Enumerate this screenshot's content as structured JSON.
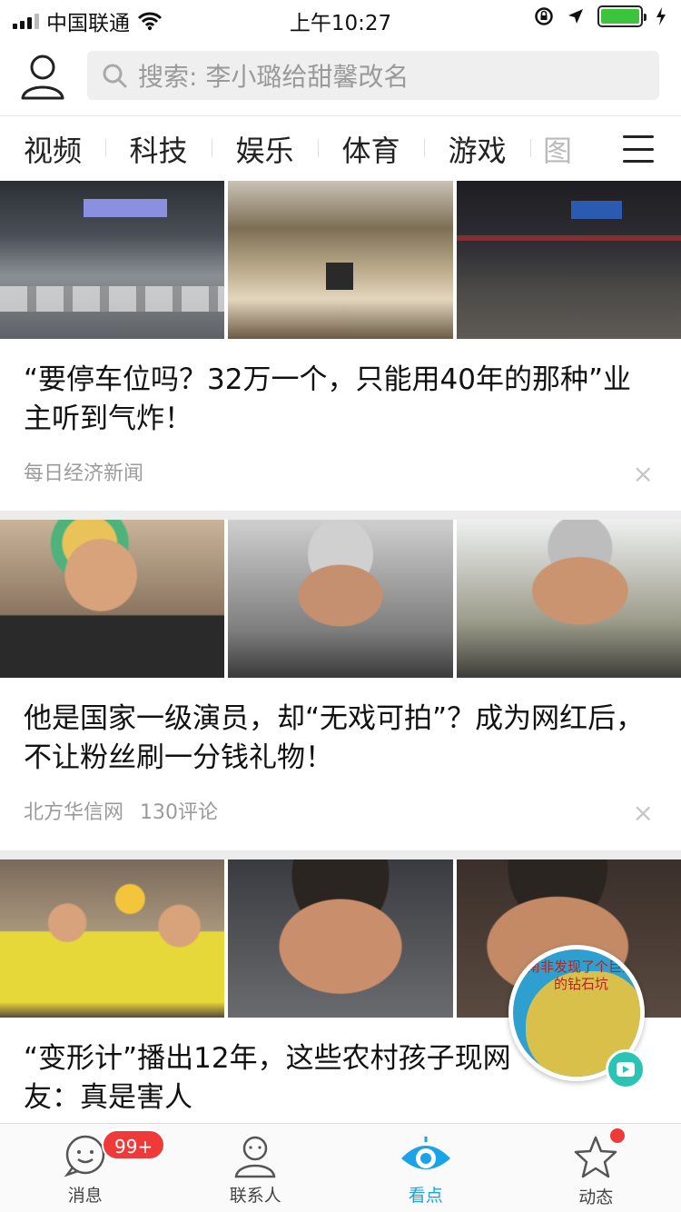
{
  "status_bar": {
    "carrier": "中国联通",
    "time": "上午10:27"
  },
  "search": {
    "placeholder": "搜索: 李小璐给甜馨改名"
  },
  "tabs": [
    {
      "label": "视频"
    },
    {
      "label": "科技"
    },
    {
      "label": "娱乐"
    },
    {
      "label": "体育"
    },
    {
      "label": "游戏"
    },
    {
      "label": "图"
    }
  ],
  "feed": [
    {
      "title": "“要停车位吗？32万一个，只能用40年的那种”业主听到气炸！",
      "source": "每日经济新闻",
      "comments": "",
      "close": "×",
      "images": [
        "parking-garage-image",
        "parking-lot-image",
        "parking-exit-image"
      ]
    },
    {
      "title": "他是国家一级演员，却“无戏可拍”？成为网红后，不让粉丝刷一分钱礼物！",
      "source": "北方华信网",
      "comments": "130评论",
      "close": "×",
      "images": [
        "actor-portrait-image",
        "actor-talking-image",
        "actor-closeup-image"
      ]
    },
    {
      "title": "“变形计”播出12年，这些农村孩子现网友：真是害人",
      "source": "",
      "comments": "",
      "close": "",
      "images": [
        "family-photo-image",
        "boy-crying-image",
        "boy-closeup-image"
      ]
    }
  ],
  "floating_video": {
    "caption": "南非发现了个巨大的钻石坑"
  },
  "tabbar": [
    {
      "label": "消息",
      "badge": "99+",
      "icon": "chat-bubble-icon"
    },
    {
      "label": "联系人",
      "icon": "person-icon"
    },
    {
      "label": "看点",
      "icon": "eye-icon",
      "active": true
    },
    {
      "label": "动态",
      "icon": "star-icon"
    }
  ],
  "colors": {
    "accent": "#1aa3e8",
    "badge": "#f03a3a",
    "battery": "#3cc43c"
  }
}
